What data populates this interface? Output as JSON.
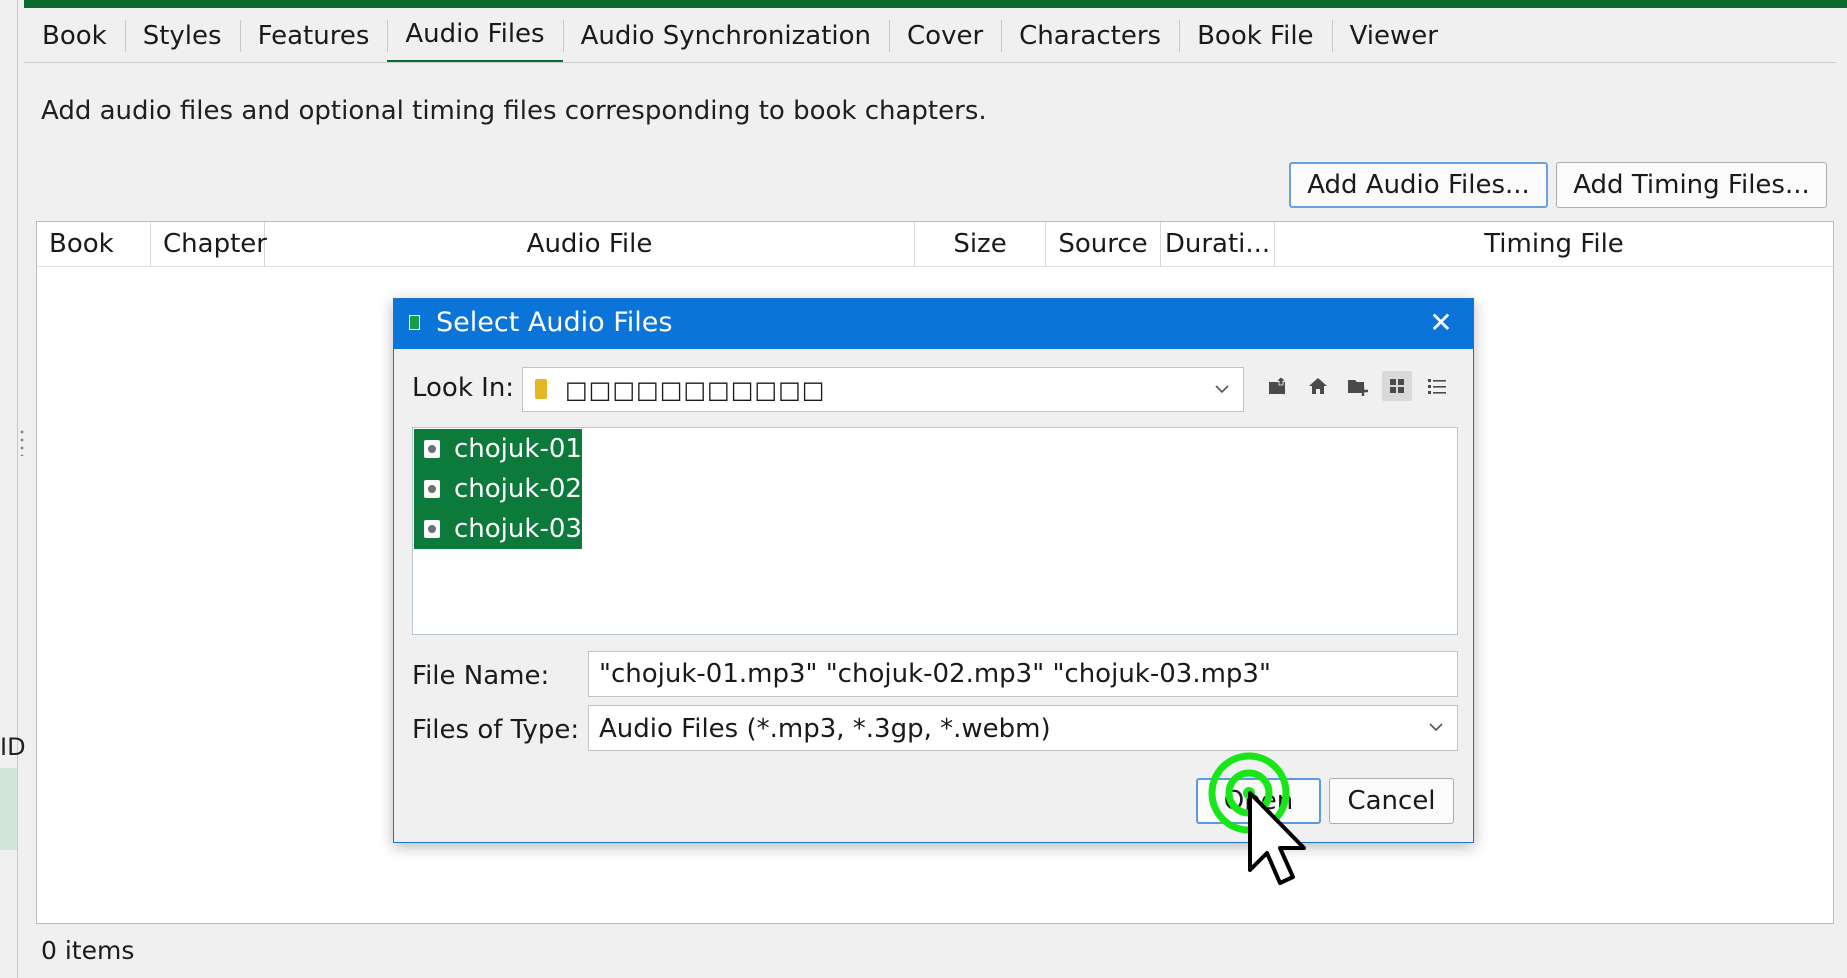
{
  "tabs": [
    {
      "label": "Book",
      "active": false
    },
    {
      "label": "Styles",
      "active": false
    },
    {
      "label": "Features",
      "active": false
    },
    {
      "label": "Audio Files",
      "active": true
    },
    {
      "label": "Audio Synchronization",
      "active": false
    },
    {
      "label": "Cover",
      "active": false
    },
    {
      "label": "Characters",
      "active": false
    },
    {
      "label": "Book File",
      "active": false
    },
    {
      "label": "Viewer",
      "active": false
    }
  ],
  "description": "Add audio files and optional timing files corresponding to book chapters.",
  "buttons": {
    "add_audio": "Add Audio Files...",
    "add_timing": "Add Timing Files..."
  },
  "table": {
    "columns": [
      "Book",
      "Chapter",
      "Audio File",
      "Size",
      "Source",
      "Durati...",
      "Timing File"
    ],
    "rows": []
  },
  "status": "0 items",
  "left_panel_glimpse": "ID",
  "dialog": {
    "title": "Select Audio Files",
    "look_in_label": "Look In:",
    "look_in_value": "□□□□□□□□□□□",
    "toolbar_icons": [
      "up-one-level-icon",
      "home-icon",
      "new-folder-icon",
      "list-view-icon",
      "details-view-icon"
    ],
    "files": [
      {
        "name": "chojuk-01",
        "selected": true
      },
      {
        "name": "chojuk-02",
        "selected": true
      },
      {
        "name": "chojuk-03",
        "selected": true
      }
    ],
    "file_name_label": "File Name:",
    "file_name_value": "\"chojuk-01.mp3\" \"chojuk-02.mp3\" \"chojuk-03.mp3\"",
    "files_of_type_label": "Files of Type:",
    "files_of_type_value": "Audio Files (*.mp3, *.3gp, *.webm)",
    "open_label": "Open",
    "cancel_label": "Cancel"
  },
  "colors": {
    "accent_green": "#0b6b2f",
    "selection_green": "#0b7a3a",
    "title_blue": "#0a74d9",
    "click_indicator": "#19e619"
  }
}
